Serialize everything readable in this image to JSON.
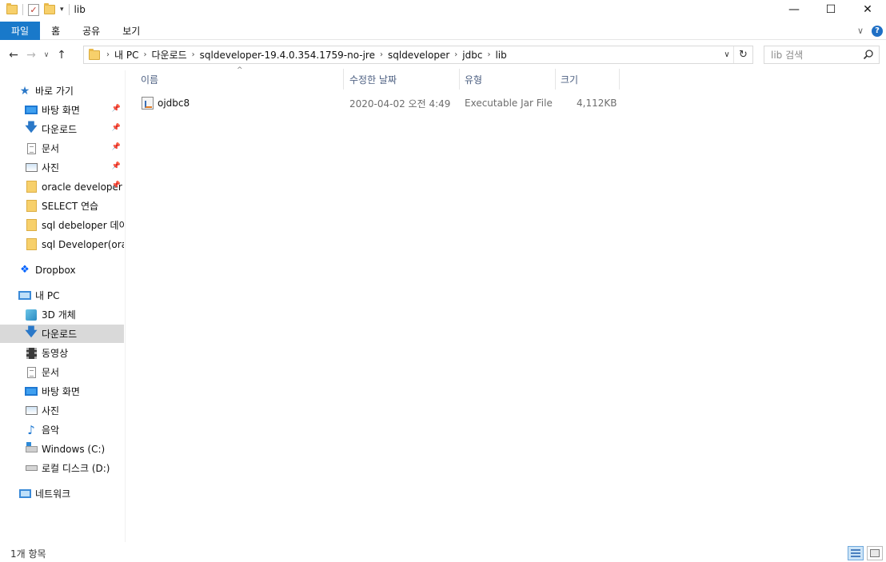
{
  "window": {
    "title": "lib",
    "minimize_glyph": "—",
    "maximize_glyph": "☐",
    "close_glyph": "✕"
  },
  "ribbon": {
    "tabs": [
      "파일",
      "홈",
      "공유",
      "보기"
    ],
    "expand_glyph": "∨",
    "help_glyph": "?"
  },
  "nav": {
    "back_glyph": "←",
    "forward_glyph": "→",
    "recent_glyph": "∨",
    "up_glyph": "↑"
  },
  "address": {
    "crumbs": [
      "내 PC",
      "다운로드",
      "sqldeveloper-19.4.0.354.1759-no-jre",
      "sqldeveloper",
      "jdbc",
      "lib"
    ],
    "separator": "›",
    "dropdown_glyph": "∨",
    "refresh_glyph": "↻"
  },
  "search": {
    "placeholder": "lib 검색"
  },
  "sidebar": {
    "quick_access": "바로 가기",
    "quick_items": [
      "바탕 화면",
      "다운로드",
      "문서",
      "사진",
      "oracle developer",
      "SELECT 연습",
      "sql debeloper 데이터",
      "sql Developer(oracle)"
    ],
    "dropbox": "Dropbox",
    "this_pc": "내 PC",
    "pc_items": [
      "3D 개체",
      "다운로드",
      "동영상",
      "문서",
      "바탕 화면",
      "사진",
      "음악",
      "Windows (C:)",
      "로컬 디스크 (D:)"
    ],
    "network": "네트워크",
    "selected": "다운로드"
  },
  "columns": {
    "name": "이름",
    "modified": "수정한 날짜",
    "type": "유형",
    "size": "크기",
    "sort_glyph": "^"
  },
  "files": [
    {
      "name": "ojdbc8",
      "modified": "2020-04-02 오전 4:49",
      "type": "Executable Jar File",
      "size": "4,112KB"
    }
  ],
  "status": {
    "count": "1개 항목"
  },
  "colors": {
    "file_tab": "#1979ca",
    "selection": "#d9d9d9",
    "column_header_text": "#4d6082"
  }
}
